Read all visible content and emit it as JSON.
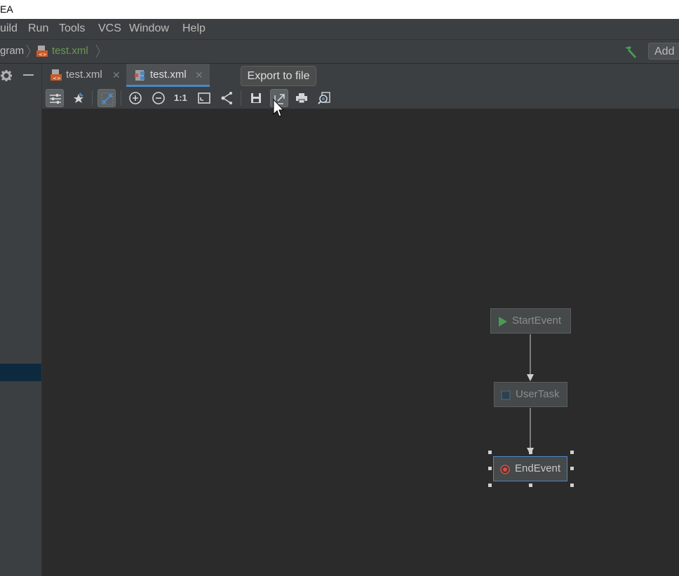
{
  "window": {
    "title": "EA"
  },
  "menu": [
    "uild",
    "Run",
    "Tools",
    "VCS",
    "Window",
    "Help"
  ],
  "breadcrumb": {
    "parent": "gram",
    "file": "test.xml"
  },
  "navbar": {
    "add_label": "Add"
  },
  "tabs": [
    {
      "label": "test.xml",
      "icon": "xml-file-icon",
      "active": false
    },
    {
      "label": "test.xml",
      "icon": "diagram-file-icon",
      "active": true
    }
  ],
  "tooltip": "Export to file",
  "toolbar": {
    "buttons": [
      "settings-sliders-icon",
      "pin-star-icon",
      "layout-toggle-icon",
      "zoom-in-icon",
      "zoom-out-icon",
      "actual-size-icon",
      "fit-content-icon",
      "layout-icon",
      "save-icon",
      "export-icon",
      "print-icon",
      "print-preview-icon"
    ],
    "actual_size_label": "1:1"
  },
  "diagram": {
    "nodes": [
      {
        "label": "StartEvent",
        "kind": "start-event"
      },
      {
        "label": "UserTask",
        "kind": "user-task"
      },
      {
        "label": "EndEvent",
        "kind": "end-event",
        "selected": true
      }
    ],
    "edges": [
      {
        "from": "StartEvent",
        "to": "UserTask"
      },
      {
        "from": "UserTask",
        "to": "EndEvent"
      }
    ]
  },
  "colors": {
    "accent": "#4a88c7",
    "green": "#499c54",
    "panel": "#3c3f41",
    "canvas": "#2b2b2b",
    "end_event": "#c75450"
  }
}
